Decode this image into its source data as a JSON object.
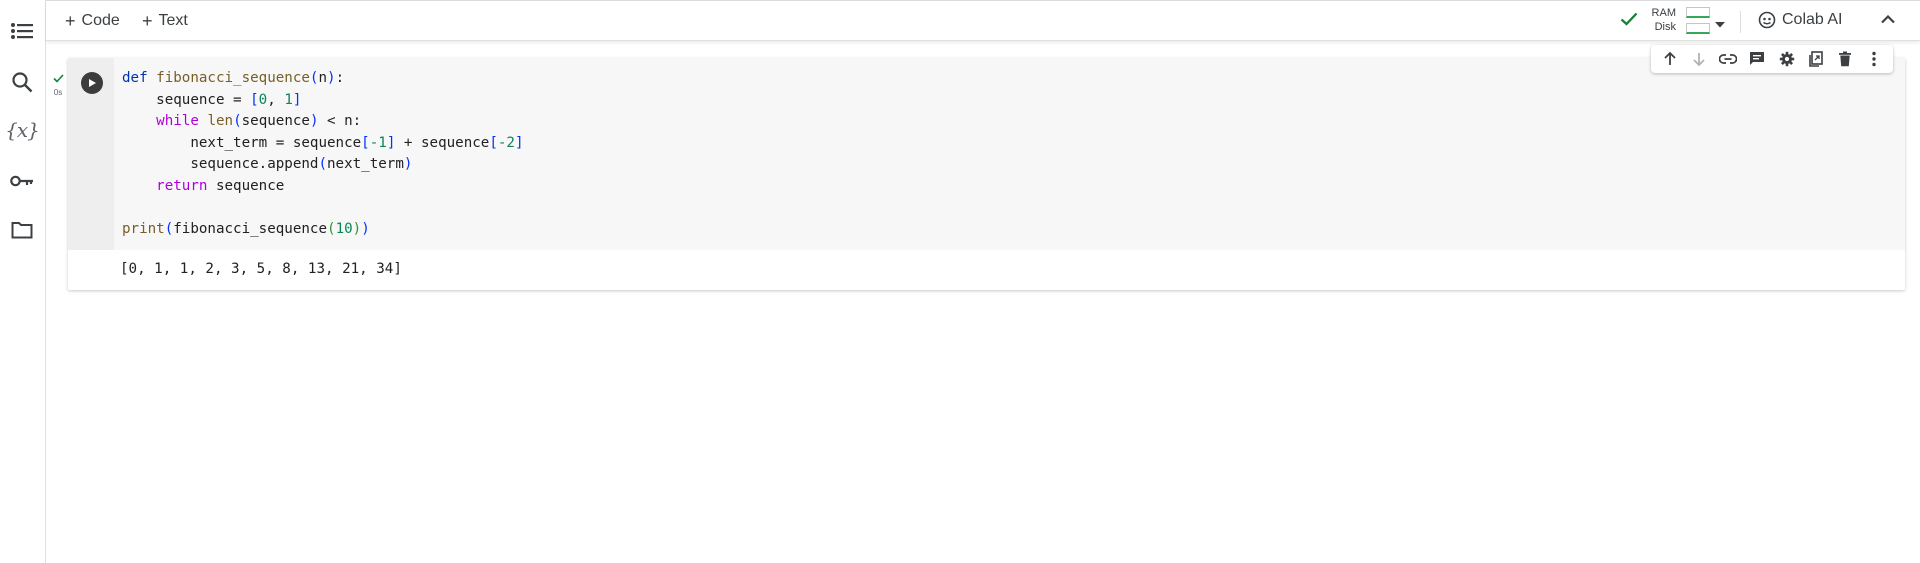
{
  "toolbar": {
    "add_code_label": "Code",
    "add_text_label": "Text",
    "ram_label": "RAM",
    "disk_label": "Disk",
    "colab_ai_label": "Colab AI"
  },
  "cell": {
    "exec_time": "0s",
    "code_lines": [
      "def fibonacci_sequence(n):",
      "    sequence = [0, 1]",
      "    while len(sequence) < n:",
      "        next_term = sequence[-1] + sequence[-2]",
      "        sequence.append(next_term)",
      "    return sequence",
      "",
      "print(fibonacci_sequence(10))"
    ],
    "output": "[0, 1, 1, 2, 3, 5, 8, 13, 21, 34]"
  },
  "icons": {
    "rail": [
      "toc-icon",
      "search-icon",
      "variables-icon",
      "secrets-key-icon",
      "folder-icon"
    ],
    "cell_toolbar": [
      "arrow-up-icon",
      "arrow-down-icon",
      "link-icon",
      "comment-icon",
      "gear-icon",
      "mirror-cell-icon",
      "delete-icon",
      "more-vert-icon"
    ]
  },
  "colors": {
    "status_check": "#188038",
    "bar_fill": "#34a853",
    "run_button": "#3c3c3c"
  }
}
